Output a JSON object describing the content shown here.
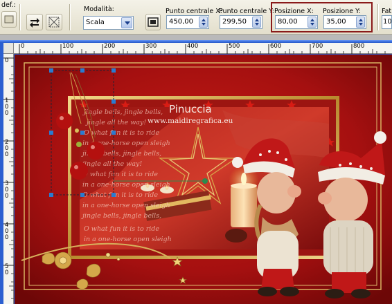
{
  "toolbar": {
    "preset_label": "def.:",
    "mode_label": "Modalità:",
    "mode_value": "Scala",
    "center_x_label": "Punto centrale X:",
    "center_x_value": "450,00",
    "center_y_label": "Punto centrale Y:",
    "center_y_value": "299,50",
    "pos_x_label": "Posizione X:",
    "pos_x_value": "80,00",
    "pos_y_label": "Posizione Y:",
    "pos_y_value": "35,00",
    "extra_label": "Fat",
    "extra_value": "10"
  },
  "ruler_top": [
    "0",
    "100",
    "200",
    "300",
    "400",
    "500",
    "600",
    "700",
    "800"
  ],
  "ruler_left": [
    "0",
    "1\n0\n0",
    "2\n0\n0",
    "3\n0\n0",
    "4\n0\n0",
    "5\n0"
  ],
  "image": {
    "signature": "Pinuccia",
    "website": "www.maidiregrafica.eu",
    "poem_lines": [
      "jingle bells, jingle bells,",
      "jingle all the way!",
      "O what fun it is to ride",
      "in a one-horse open sleigh",
      "jingle bells, jingle bells,",
      "jingle all the way!",
      "O what fun it is to ride",
      "in a one-horse open sleigh",
      "O what fun it is to ride",
      "in a one-horse open sleigh",
      "jingle bells, jingle bells,"
    ],
    "poem_footer": [
      "O what fun it is to ride",
      "in a one-horse open sleigh"
    ]
  },
  "colors": {
    "toolbar_bg": "#ece9d8",
    "highlight_border": "#8a1a1a",
    "canvas_red": "#a8100f",
    "window_blue": "#2b5fd0"
  }
}
